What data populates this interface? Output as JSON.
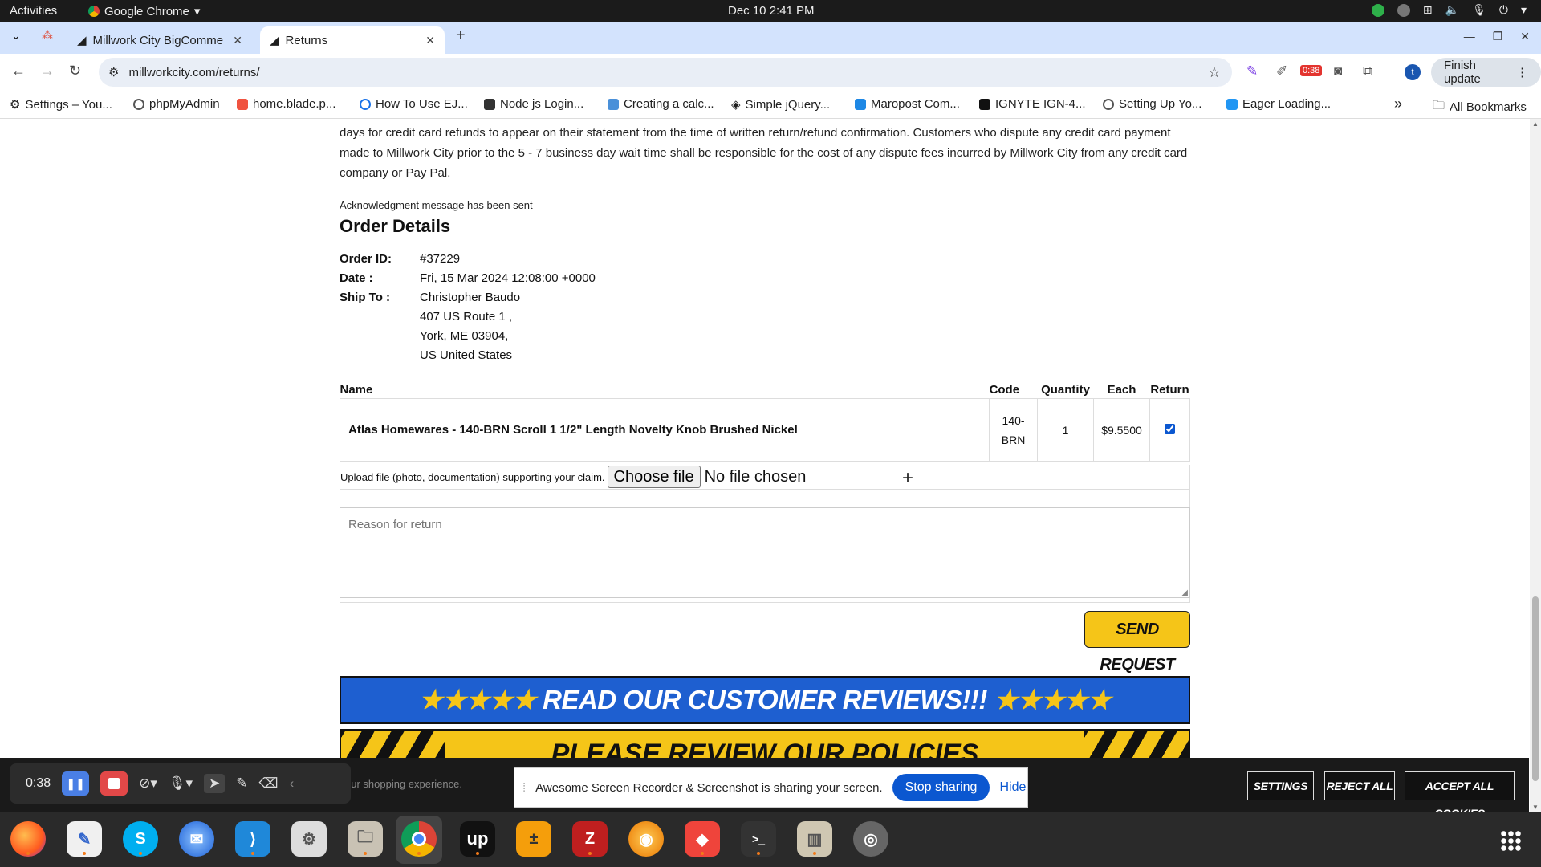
{
  "system": {
    "activities": "Activities",
    "app_name": "Google Chrome",
    "clock": "Dec 10  2:41 PM"
  },
  "tabs": [
    {
      "label": "Millwork City BigComme",
      "active": false
    },
    {
      "label": "Returns",
      "active": true
    }
  ],
  "toolbar": {
    "url": "millworkcity.com/returns/",
    "finish_update": "Finish update",
    "recorder_badge": "0:38",
    "avatar_letter": "t"
  },
  "bookmarks": [
    "Settings – You...",
    "phpMyAdmin",
    "home.blade.p...",
    "How To Use EJ...",
    "Node js Login...",
    "Creating a calc...",
    "Simple jQuery...",
    "Maropost Com...",
    "IGNYTE IGN-4...",
    "Setting Up Yo...",
    "Eager Loading..."
  ],
  "bookmarks_more": "»",
  "all_bookmarks": "All Bookmarks",
  "page": {
    "refund_text": "days for credit card refunds to appear on their statement from the time of written return/refund confirmation. Customers who dispute any credit card payment made to Millwork City prior to the 5 - 7 business day wait time shall be responsible for the cost of any dispute fees incurred by Millwork City from any credit card company or Pay Pal.",
    "ack": "Acknowledgment message has been sent",
    "order_heading": "Order Details",
    "order": {
      "id_label": "Order ID:",
      "id": "#37229",
      "date_label": "Date :",
      "date": "Fri, 15 Mar 2024 12:08:00 +0000",
      "ship_label": "Ship To :",
      "ship_name": "Christopher Baudo",
      "ship_line1": "407 US Route 1 ,",
      "ship_line2": "York, ME 03904,",
      "ship_line3": "US United States"
    },
    "table": {
      "headers": {
        "name": "Name",
        "code": "Code",
        "quantity": "Quantity",
        "each": "Each",
        "return": "Return"
      },
      "rows": [
        {
          "name": "Atlas Homewares - 140-BRN Scroll 1 1/2\" Length Novelty Knob Brushed Nickel",
          "code_1": "140-",
          "code_2": "BRN",
          "quantity": "1",
          "each": "$9.5500",
          "return_checked": true
        }
      ]
    },
    "upload_label": "Upload file (photo, documentation) supporting your claim.",
    "choose_file": "Choose file",
    "no_file": "No file chosen",
    "reason_placeholder": "Reason for return",
    "send_button": "SEND REQUEST",
    "reviews_banner": "READ OUR CUSTOMER REVIEWS!!!",
    "reviews_stars": "★★★★★",
    "policies_banner": "PLEASE REVIEW OUR POLICIES"
  },
  "cookie": {
    "text": "our shopping experience.",
    "settings": "SETTINGS",
    "reject": "REJECT ALL",
    "accept": "ACCEPT ALL COOKIES"
  },
  "recorder": {
    "time": "0:38"
  },
  "share_notice": {
    "text": "Awesome Screen Recorder & Screenshot is sharing your screen.",
    "stop": "Stop sharing",
    "hide": "Hide"
  },
  "dock": [
    "firefox-icon",
    "text-editor-icon",
    "skype-icon",
    "thunderbird-icon",
    "vscode-icon",
    "settings-icon",
    "files-icon",
    "chrome-icon",
    "upwork-icon",
    "calculator-icon",
    "filezilla-icon",
    "blender-icon",
    "anydesk-icon",
    "terminal-icon",
    "archive-icon",
    "screenshot-icon"
  ]
}
